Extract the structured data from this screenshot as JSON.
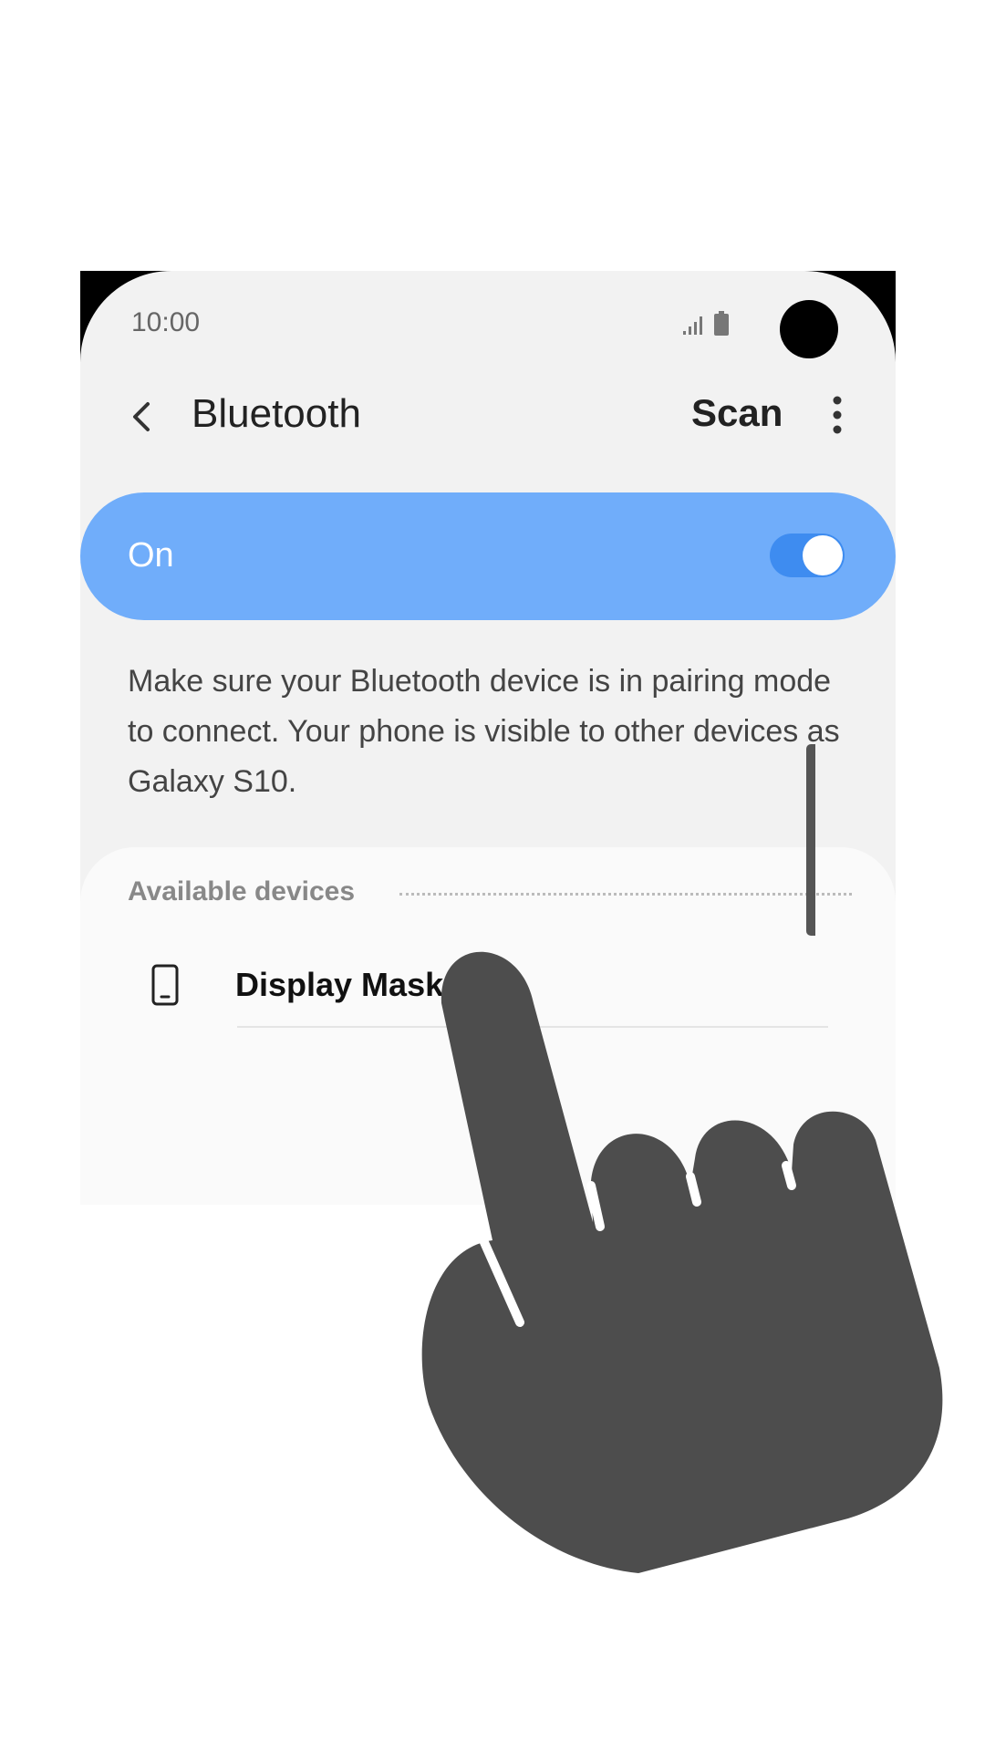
{
  "status_bar": {
    "time": "10:00",
    "signal_icon": "signal-icon",
    "battery_icon": "battery-icon"
  },
  "app_bar": {
    "back_icon": "back-arrow-icon",
    "title": "Bluetooth",
    "scan_label": "Scan",
    "more_icon": "more-vertical-icon"
  },
  "toggle": {
    "label": "On",
    "state": "on",
    "accent_color": "#70adfa"
  },
  "description": "Make sure your Bluetooth device is in pairing mode to connect. Your phone is visible to other devices as Galaxy S10.",
  "available_devices": {
    "header": "Available devices",
    "items": [
      {
        "icon": "phone-icon",
        "name": "Display Mask"
      }
    ]
  },
  "overlay": {
    "icon": "pointing-hand-icon",
    "color": "#4d4d4d"
  }
}
